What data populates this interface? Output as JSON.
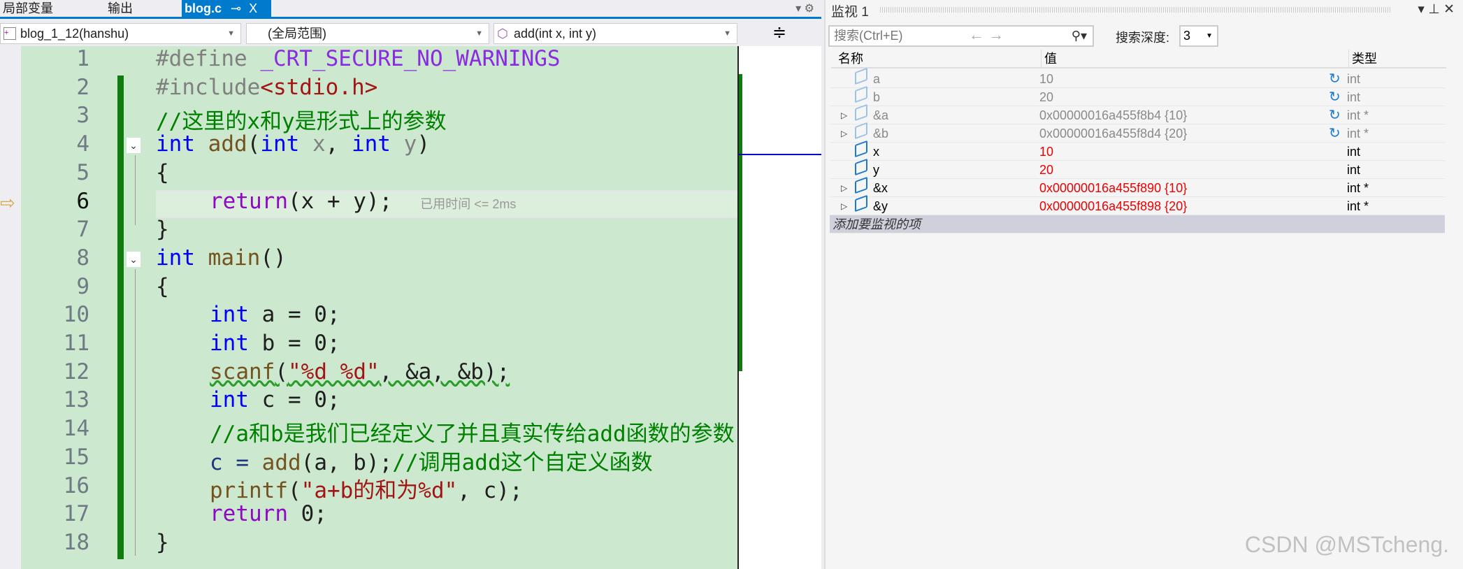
{
  "tabs": {
    "locals": "局部变量",
    "output": "输出",
    "file": "blog.c",
    "pin": "⊸",
    "close": "X"
  },
  "nav": {
    "project": "blog_1_12(hanshu)",
    "scope": "(全局范围)",
    "member": "add(int x, int y)"
  },
  "code": {
    "lines": [
      "1",
      "2",
      "3",
      "4",
      "5",
      "6",
      "7",
      "8",
      "9",
      "10",
      "11",
      "12",
      "13",
      "14",
      "15",
      "16",
      "17",
      "18"
    ],
    "l1a": "#define ",
    "l1b": "_CRT_SECURE_NO_WARNINGS",
    "l2a": "#include",
    "l2b": "<stdio.h>",
    "l3": "//这里的x和y是形式上的参数",
    "l4a": "int ",
    "l4b": "add",
    "l4c": "(",
    "l4d": "int ",
    "l4e": "x",
    ", ": ", ",
    "l4f": "int ",
    "l4g": "y",
    "l4h": ")",
    "l5": "{",
    "l6a": "return",
    "l6b": "(x + y);",
    "l6hint": "已用时间 <= 2ms",
    "l7": "}",
    "l8a": "int ",
    "l8b": "main",
    "l8c": "()",
    "l9": "{",
    "l10a": "int ",
    "l10b": "a = 0;",
    "l11a": "int ",
    "l11b": "b = 0;",
    "l12a": "scanf",
    "l12b": "(",
    "l12c": "\"%d %d\"",
    "l12d": ", &a, &b);",
    "l13a": "int ",
    "l13b": "c = 0;",
    "l14": "//a和b是我们已经定义了并且真实传给add函数的参数",
    "l15a": "c = ",
    "l15b": "add",
    "l15c": "(a, b);",
    "l15d": "//调用add这个自定义函数",
    "l16a": "printf",
    "l16b": "(",
    "l16c": "\"a+b的和为%d\"",
    "l16d": ", c);",
    "l17a": "return",
    "l17b": " 0;",
    "l18": "}"
  },
  "watch": {
    "title": "监视 1",
    "search_placeholder": "搜索(Ctrl+E)",
    "depth_label": "搜索深度:",
    "depth": "3",
    "headers": {
      "name": "名称",
      "value": "值",
      "type": "类型"
    },
    "rows": [
      {
        "name": "a",
        "value": "10",
        "type": "int"
      },
      {
        "name": "b",
        "value": "20",
        "type": "int"
      },
      {
        "name": "&a",
        "value": "0x00000016a455f8b4 {10}",
        "type": "int *"
      },
      {
        "name": "&b",
        "value": "0x00000016a455f8d4 {20}",
        "type": "int *"
      },
      {
        "name": "x",
        "value": "10",
        "type": "int"
      },
      {
        "name": "y",
        "value": "20",
        "type": "int"
      },
      {
        "name": "&x",
        "value": "0x00000016a455f890 {10}",
        "type": "int *"
      },
      {
        "name": "&y",
        "value": "0x00000016a455f898 {20}",
        "type": "int *"
      }
    ],
    "add_item": "添加要监视的项"
  },
  "watermark": "CSDN @MSTcheng."
}
